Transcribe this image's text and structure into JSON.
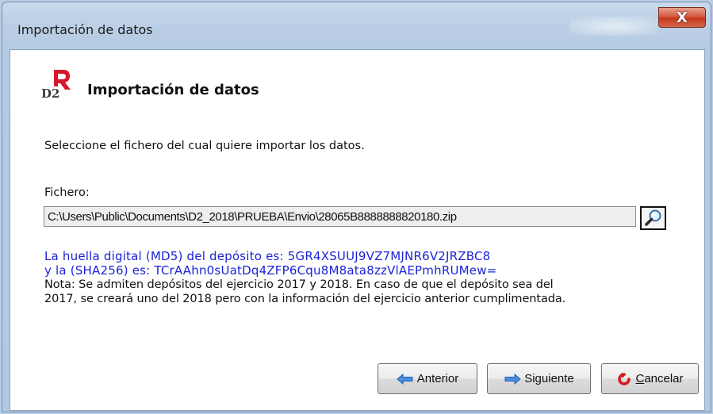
{
  "window": {
    "title": "Importación de datos",
    "close_label": "X"
  },
  "header": {
    "logo_text": "D2",
    "title": "Importación de datos"
  },
  "main": {
    "instruction": "Seleccione el fichero del cual quiere importar los datos.",
    "file_label": "Fichero:",
    "file_value": "C:\\Users\\Public\\Documents\\D2_2018\\PRUEBA\\Envio\\28065B8888888820180.zip",
    "md5_line": "La huella digital (MD5) del depósito es: 5GR4XSUUJ9VZ7MJNR6V2JRZBC8",
    "sha_line": "y la (SHA256) es: TCrAAhn0sUatDq4ZFP6Cqu8M8ata8zzVlAEPmhRUMew=",
    "note_line1": "Nota: Se admiten depósitos del ejercicio 2017 y 2018. En caso de que el depósito sea del",
    "note_line2": "2017, se creará uno del 2018 pero con la información del ejercicio anterior cumplimentada."
  },
  "buttons": {
    "prev_label": "Anterior",
    "next_label": "Siguiente",
    "cancel_first": "C",
    "cancel_rest": "ancelar"
  },
  "icons": {
    "prev": "arrow-left-icon",
    "next": "arrow-right-icon",
    "cancel": "cancel-icon",
    "browse": "magnifier-icon"
  },
  "colors": {
    "info_text": "#1b23d6",
    "logo_red": "#d7182a",
    "close_button": "#c4391d"
  }
}
